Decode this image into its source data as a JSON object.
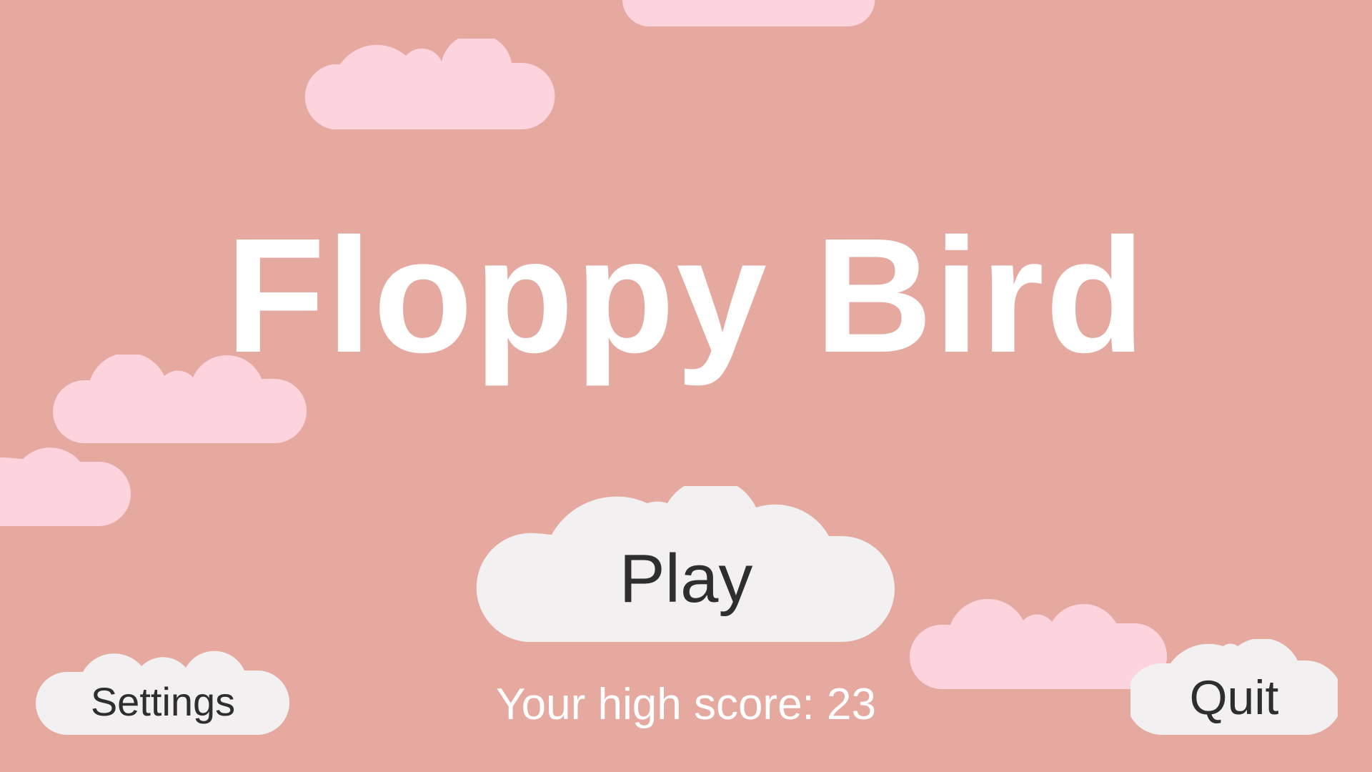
{
  "game": {
    "title": "Floppy Bird",
    "background_color": "#e6a9a0",
    "cloud_color": "#fdd3de",
    "button_color": "#f2f0f0"
  },
  "menu": {
    "play_label": "Play",
    "settings_label": "Settings",
    "quit_label": "Quit"
  },
  "high_score": {
    "label": "Your high score:",
    "value": "23"
  }
}
